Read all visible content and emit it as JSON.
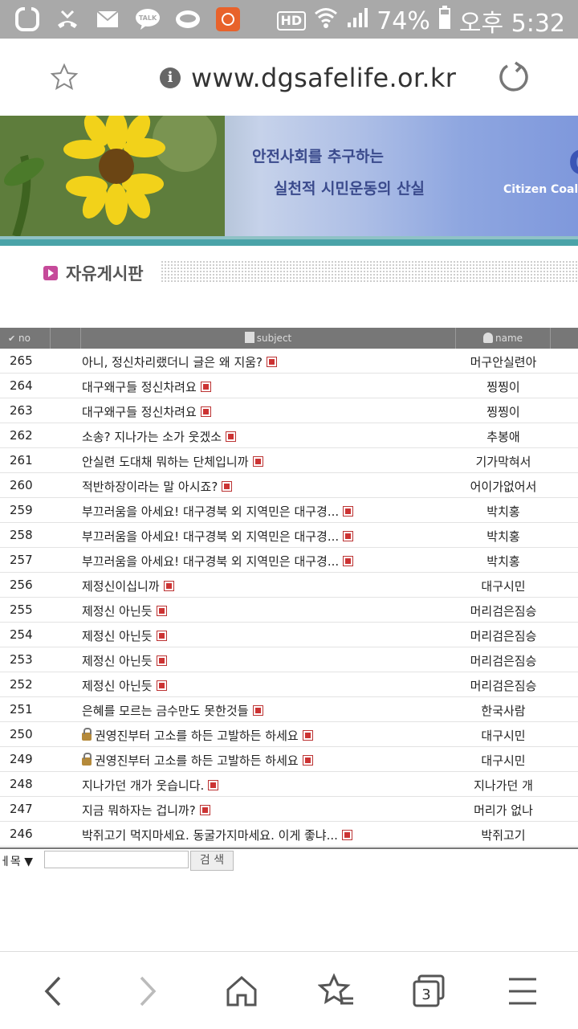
{
  "status_bar": {
    "battery": "74%",
    "time": "오후 5:32",
    "hd_label": "HD",
    "talk_label": "TALK"
  },
  "browser": {
    "url": "www.dgsafelife.or.kr",
    "tab_count": "3"
  },
  "banner": {
    "line1": "안전사회를 추구하는",
    "line2": "실천적 시민운동의 산실",
    "english": "Citizen Coaliti",
    "letter": "C"
  },
  "board": {
    "title": "자유게시판"
  },
  "table": {
    "headers": {
      "no": "no",
      "subject": "subject",
      "name": "name"
    },
    "rows": [
      {
        "no": "265",
        "subject": "아니, 정신차리랬더니 글은 왜 지움?",
        "name": "머구안실련아",
        "locked": false
      },
      {
        "no": "264",
        "subject": "대구왜구들 정신차려요",
        "name": "찡찡이",
        "locked": false
      },
      {
        "no": "263",
        "subject": "대구왜구들 정신차려요",
        "name": "찡찡이",
        "locked": false
      },
      {
        "no": "262",
        "subject": "소송? 지나가는 소가 웃겠소",
        "name": "추봉애",
        "locked": false
      },
      {
        "no": "261",
        "subject": "안실련 도대채 뭐하는 단체입니까",
        "name": "기가막혀서",
        "locked": false
      },
      {
        "no": "260",
        "subject": "적반하장이라는 말 아시죠?",
        "name": "어이가없어서",
        "locked": false
      },
      {
        "no": "259",
        "subject": "부끄러움을 아세요! 대구경북 외 지역민은 대구경...",
        "name": "박치홍",
        "locked": false
      },
      {
        "no": "258",
        "subject": "부끄러움을 아세요! 대구경북 외 지역민은 대구경...",
        "name": "박치홍",
        "locked": false
      },
      {
        "no": "257",
        "subject": "부끄러움을 아세요! 대구경북 외 지역민은 대구경...",
        "name": "박치홍",
        "locked": false
      },
      {
        "no": "256",
        "subject": "제정신이십니까",
        "name": "대구시민",
        "locked": false
      },
      {
        "no": "255",
        "subject": "제정신 아닌듯",
        "name": "머리검은짐승",
        "locked": false
      },
      {
        "no": "254",
        "subject": "제정신 아닌듯",
        "name": "머리검은짐승",
        "locked": false
      },
      {
        "no": "253",
        "subject": "제정신 아닌듯",
        "name": "머리검은짐승",
        "locked": false
      },
      {
        "no": "252",
        "subject": "제정신 아닌듯",
        "name": "머리검은짐승",
        "locked": false
      },
      {
        "no": "251",
        "subject": "은혜를 모르는 금수만도 못한것들",
        "name": "한국사람",
        "locked": false
      },
      {
        "no": "250",
        "subject": "권영진부터 고소를 하든 고발하든 하세요",
        "name": "대구시민",
        "locked": true
      },
      {
        "no": "249",
        "subject": "권영진부터 고소를 하든 고발하든 하세요",
        "name": "대구시민",
        "locked": true
      },
      {
        "no": "248",
        "subject": "지나가던 개가 웃습니다.",
        "name": "지나가던 개",
        "locked": false
      },
      {
        "no": "247",
        "subject": "지금 뭐하자는 겁니까?",
        "name": "머리가 없나",
        "locked": false
      },
      {
        "no": "246",
        "subject": "박쥐고기 먹지마세요. 동굴가지마세요. 이게 좋냐...",
        "name": "박쥐고기",
        "locked": false
      }
    ]
  },
  "search": {
    "select_label": "ㅔ목 ▼",
    "input_value": "",
    "button_label": "검 색"
  },
  "colors": {
    "header_bg": "#777777",
    "status_bar_bg": "#a9a9a9",
    "teal_stripe": "#4aa3a8",
    "banner_text": "#3a4a8c"
  }
}
